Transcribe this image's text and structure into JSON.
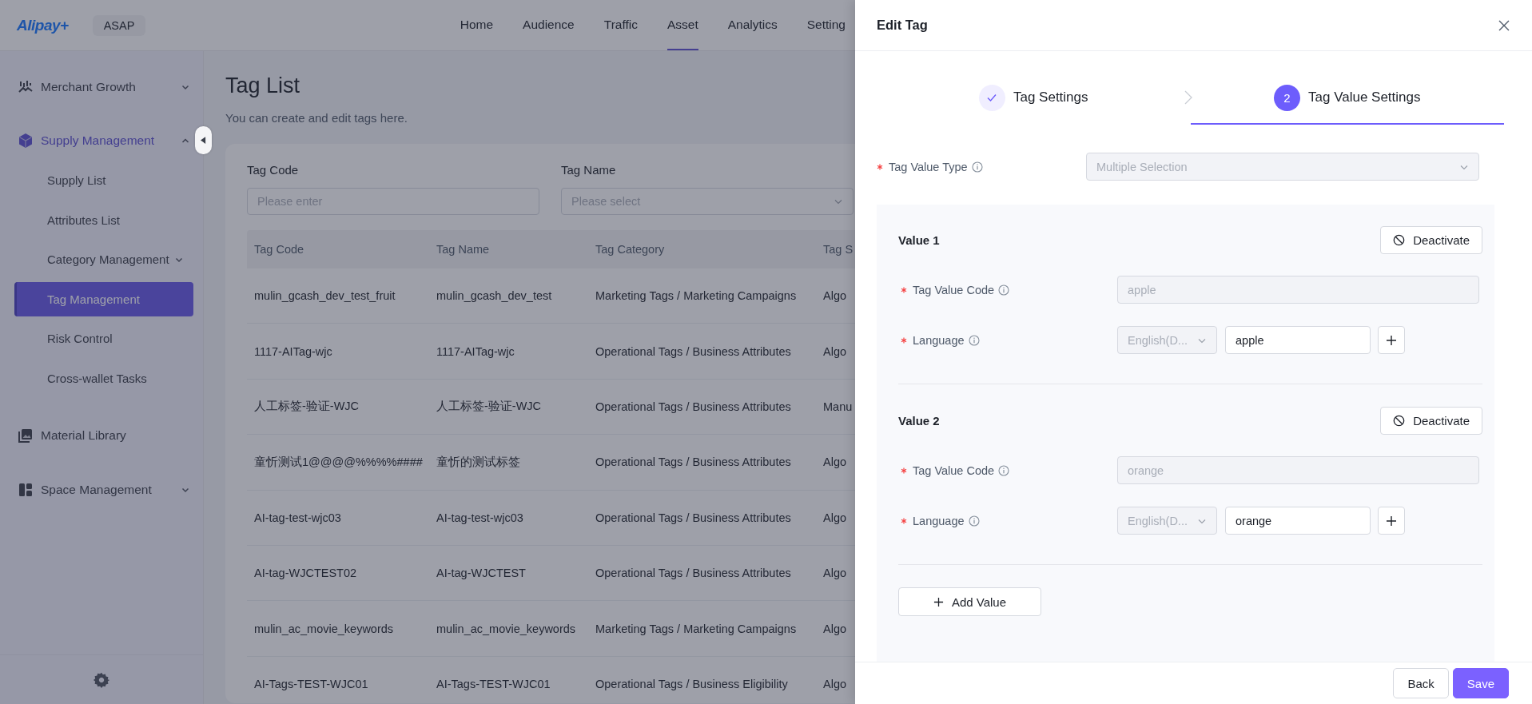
{
  "header": {
    "logo": "Alipay+",
    "workspace": "ASAP",
    "nav": [
      {
        "label": "Home",
        "selected": false
      },
      {
        "label": "Audience",
        "selected": false
      },
      {
        "label": "Traffic",
        "selected": false
      },
      {
        "label": "Asset",
        "selected": true
      },
      {
        "label": "Analytics",
        "selected": false
      },
      {
        "label": "Setting",
        "selected": false
      }
    ]
  },
  "sidebar": {
    "items": [
      {
        "label": "Merchant Growth",
        "selected": false,
        "expanded": false
      },
      {
        "label": "Supply Management",
        "selected": true,
        "expanded": true,
        "children": [
          {
            "label": "Supply List",
            "selected": false
          },
          {
            "label": "Attributes List",
            "selected": false
          },
          {
            "label": "Category Management",
            "selected": false,
            "expanded": false
          },
          {
            "label": "Tag Management",
            "selected": true
          },
          {
            "label": "Risk Control",
            "selected": false
          },
          {
            "label": "Cross-wallet Tasks",
            "selected": false
          }
        ]
      },
      {
        "label": "Material Library",
        "selected": false
      },
      {
        "label": "Space Management",
        "selected": false,
        "expanded": false
      }
    ]
  },
  "page": {
    "title": "Tag List",
    "subtitle": "You can create and edit tags here.",
    "filters": [
      {
        "label": "Tag Code",
        "kind": "input",
        "placeholder": "Please enter"
      },
      {
        "label": "Tag Name",
        "kind": "select",
        "placeholder": "Please select"
      }
    ]
  },
  "table": {
    "columns": [
      "Tag Code",
      "Tag Name",
      "Tag Category",
      "Tag S"
    ],
    "rows": [
      [
        "mulin_gcash_dev_test_fruit",
        "mulin_gcash_dev_test",
        "Marketing Tags / Marketing Campaigns",
        "Algo"
      ],
      [
        "1117-AITag-wjc",
        "1117-AITag-wjc",
        "Operational Tags / Business Attributes",
        "Algo"
      ],
      [
        "人工标签-验证-WJC",
        "人工标签-验证-WJC",
        "Operational Tags / Business Attributes",
        "Manu"
      ],
      [
        "童忻测试1@@@@%%%%####",
        "童忻的测试标签",
        "Operational Tags / Business Attributes",
        "Algo"
      ],
      [
        "AI-tag-test-wjc03",
        "AI-tag-test-wjc03",
        "Operational Tags / Business Attributes",
        "Algo"
      ],
      [
        "AI-tag-WJCTEST02",
        "AI-tag-WJCTEST",
        "Operational Tags / Business Attributes",
        "Algo"
      ],
      [
        "mulin_ac_movie_keywords",
        "mulin_ac_movie_keywords",
        "Marketing Tags / Marketing Campaigns",
        "Algo"
      ],
      [
        "AI-Tags-TEST-WJC01",
        "AI-Tags-TEST-WJC01",
        "Operational Tags / Business Eligibility",
        "Algo"
      ]
    ]
  },
  "drawer": {
    "title": "Edit Tag",
    "steps": [
      {
        "label": "Tag Settings",
        "done": true,
        "selected": false
      },
      {
        "number": "2",
        "label": "Tag Value Settings",
        "done": false,
        "selected": true
      }
    ],
    "value_type": {
      "label": "Tag Value Type",
      "required": true,
      "value": "Multiple Selection",
      "disabled": true
    },
    "values": [
      {
        "title": "Value 1",
        "action": "Deactivate",
        "code": {
          "label": "Tag Value Code",
          "required": true,
          "value": "apple",
          "disabled": true
        },
        "language": {
          "label": "Language",
          "required": true,
          "locale": "English(D...",
          "text": "apple"
        }
      },
      {
        "title": "Value 2",
        "action": "Deactivate",
        "code": {
          "label": "Tag Value Code",
          "required": true,
          "value": "orange",
          "disabled": true
        },
        "language": {
          "label": "Language",
          "required": true,
          "locale": "English(D...",
          "text": "orange"
        }
      }
    ],
    "add_button": "Add Value",
    "buttons": [
      {
        "label": "Back",
        "kind": "default"
      },
      {
        "label": "Save",
        "kind": "primary"
      }
    ]
  }
}
